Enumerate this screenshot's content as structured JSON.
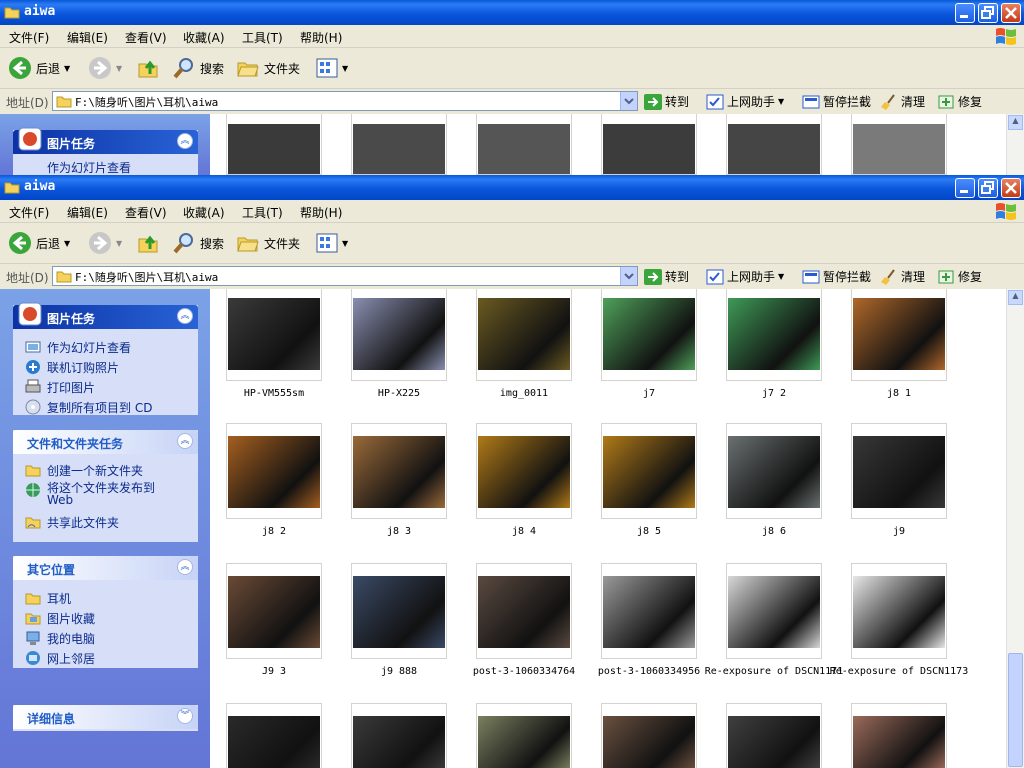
{
  "window": {
    "title": "aiwa",
    "menu": [
      "文件(F)",
      "编辑(E)",
      "查看(V)",
      "收藏(A)",
      "工具(T)",
      "帮助(H)"
    ],
    "toolbar": {
      "back_label": "后退",
      "search_label": "搜索",
      "folders_label": "文件夹"
    },
    "address": {
      "label": "地址(D)",
      "value": "F:\\随身听\\图片\\耳机\\aiwa",
      "go_label": "转到",
      "helper_label": "上网助手",
      "block_label": "暂停拦截",
      "clean_label": "清理",
      "repair_label": "修复"
    }
  },
  "sidebar": {
    "picture_tasks": {
      "title": "图片任务",
      "items": [
        "作为幻灯片查看",
        "联机订购照片",
        "打印图片",
        "复制所有项目到 CD"
      ]
    },
    "file_tasks": {
      "title": "文件和文件夹任务",
      "items": [
        "创建一个新文件夹",
        "将这个文件夹发布到 Web",
        "共享此文件夹"
      ]
    },
    "other_places": {
      "title": "其它位置",
      "items": [
        "耳机",
        "图片收藏",
        "我的电脑",
        "网上邻居"
      ]
    },
    "details": {
      "title": "详细信息"
    }
  },
  "thumbnails": [
    {
      "label": "HP-VM555sm",
      "color": "#3a3a3a"
    },
    {
      "label": "HP-X225",
      "color": "#8a8fb0"
    },
    {
      "label": "img_0011",
      "color": "#6a5a22"
    },
    {
      "label": "j7",
      "color": "#4fa05a"
    },
    {
      "label": "j7 2",
      "color": "#3f9a57"
    },
    {
      "label": "j8 1",
      "color": "#b0682a"
    },
    {
      "label": "j8 2",
      "color": "#a55f20"
    },
    {
      "label": "j8 3",
      "color": "#9a6a3a"
    },
    {
      "label": "j8 4",
      "color": "#b07a18"
    },
    {
      "label": "j8 5",
      "color": "#b07a18"
    },
    {
      "label": "j8 6",
      "color": "#6a7070"
    },
    {
      "label": "j9",
      "color": "#383838"
    },
    {
      "label": "J9 3",
      "color": "#6a4a36"
    },
    {
      "label": "j9 888",
      "color": "#3a4a66"
    },
    {
      "label": "post-3-1060334764",
      "color": "#5a4a40"
    },
    {
      "label": "post-3-1060334956",
      "color": "#9a9a9a"
    },
    {
      "label": "Re-exposure of DSCN1171",
      "color": "#d8d8d8"
    },
    {
      "label": "Re-exposure of DSCN1173",
      "color": "#e8e8e8"
    }
  ],
  "top_strip_colors": [
    "#3a3a3a",
    "#4a4a4a",
    "#555555",
    "#3c3c3c",
    "#454545",
    "#7a7a7a"
  ],
  "bottom_strip_colors": [
    "#2a2a2a",
    "#3a3a3a",
    "#7a8060",
    "#6a5040",
    "#404040",
    "#9a6a5a"
  ]
}
